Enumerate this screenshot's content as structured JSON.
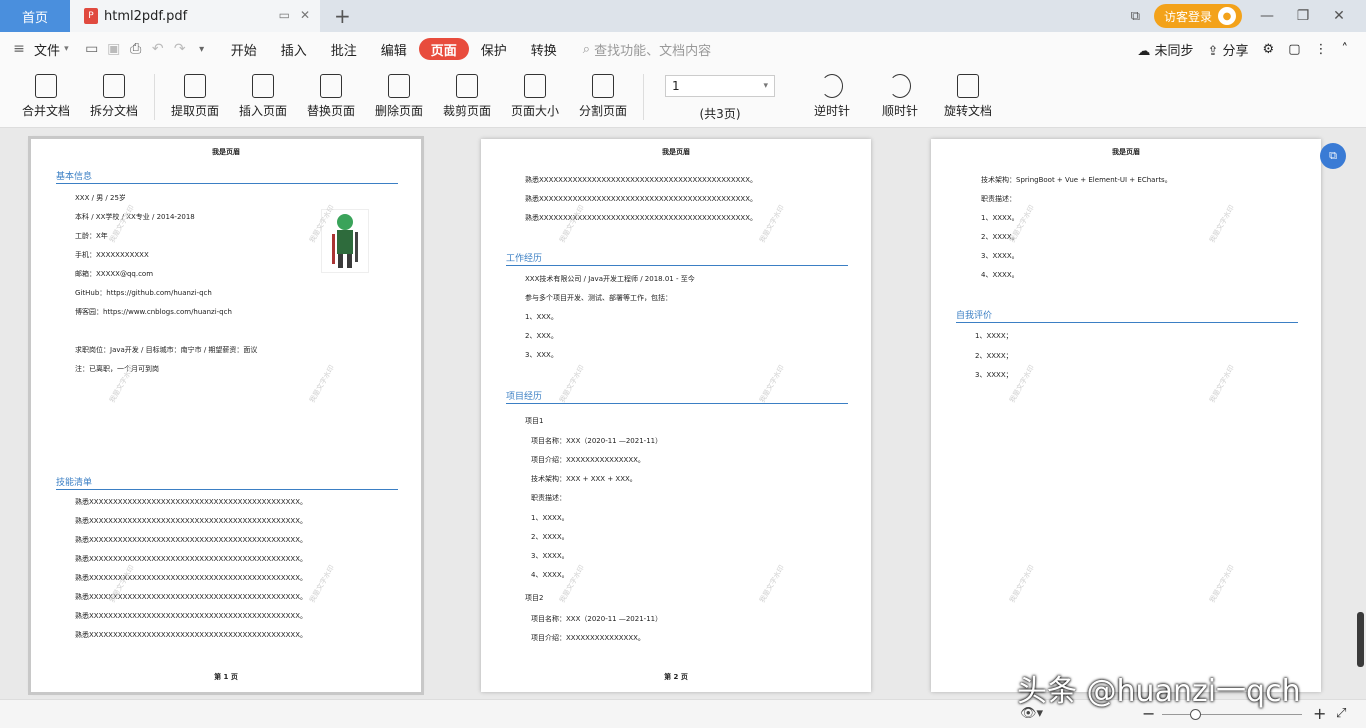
{
  "tabs": {
    "home": "首页",
    "doc": "html2pdf.pdf"
  },
  "title_right": {
    "visitor_login": "访客登录"
  },
  "menu": {
    "file": "文件",
    "items": [
      "开始",
      "插入",
      "批注",
      "编辑",
      "页面",
      "保护",
      "转换"
    ],
    "search_placeholder": "查找功能、文档内容",
    "sync": "未同步",
    "share": "分享"
  },
  "toolbar": {
    "merge": "合并文档",
    "split": "拆分文档",
    "extract": "提取页面",
    "insert": "插入页面",
    "replace": "替换页面",
    "delete": "删除页面",
    "crop": "裁剪页面",
    "size": "页面大小",
    "divide": "分割页面",
    "page_value": "1",
    "page_total": "(共3页)",
    "ccw": "逆时针",
    "cw": "顺时针",
    "rotate_doc": "旋转文档"
  },
  "doc": {
    "header": "我是页眉",
    "watermark": "我是文字水印",
    "page1": {
      "sec_basic": "基本信息",
      "basic": [
        "XXX / 男 / 25岁",
        "本科 / XX学校 / XX专业 / 2014-2018",
        "工龄：X年",
        "手机：XXXXXXXXXXX",
        "邮箱：XXXXX@qq.com",
        "GitHub：https://github.com/huanzi-qch",
        "博客园：https://www.cnblogs.com/huanzi-qch"
      ],
      "job": "求职岗位：Java开发 / 目标城市：南宁市 / 期望薪资：面议",
      "note": "注：已离职，一个月可到岗",
      "sec_skills": "技能清单",
      "skill": "熟悉XXXXXXXXXXXXXXXXXXXXXXXXXXXXXXXXXXXXXXXXXXXX。",
      "footer": "第 1 页"
    },
    "page2": {
      "top": "熟悉XXXXXXXXXXXXXXXXXXXXXXXXXXXXXXXXXXXXXXXXXXXX。",
      "sec_work": "工作经历",
      "work": [
        "XXX技术有限公司 / Java开发工程师 / 2018.01 - 至今",
        "参与多个项目开发、测试、部署等工作，包括：",
        "1、XXX。",
        "2、XXX。",
        "3、XXX。"
      ],
      "sec_proj": "项目经历",
      "p1": "项目1",
      "p1_lines": [
        "项目名称：XXX（2020-11 —2021-11）",
        "项目介绍：XXXXXXXXXXXXXXX。",
        "技术架构：XXX + XXX + XXX。",
        "职责描述：",
        "1、XXXX。",
        "2、XXXX。",
        "3、XXXX。",
        "4、XXXX。"
      ],
      "p2": "项目2",
      "p2_lines": [
        "项目名称：XXX（2020-11 —2021-11）",
        "项目介绍：XXXXXXXXXXXXXXX。"
      ],
      "footer": "第 2 页"
    },
    "page3": {
      "lines": [
        "技术架构：SpringBoot + Vue + Element-UI + ECharts。",
        "职责描述：",
        "1、XXXX。",
        "2、XXXX。",
        "3、XXXX。",
        "4、XXXX。"
      ],
      "sec_self": "自我评价",
      "self": [
        "1、XXXX；",
        "2、XXXX；",
        "3、XXXX；"
      ]
    }
  },
  "overlay": {
    "watermark": "头条 @huanzi一qch"
  }
}
